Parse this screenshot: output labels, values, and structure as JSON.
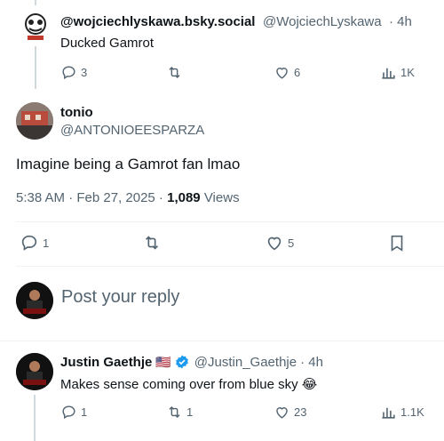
{
  "tweet1": {
    "display_name": "@wojciechlyskawa.bsky.social",
    "handle": "@WojciechLyskawa",
    "time": "· 4h",
    "text": "Ducked Gamrot",
    "actions": {
      "replies": "3",
      "likes": "6",
      "views": "1K"
    }
  },
  "main_tweet": {
    "display_name": "tonio",
    "handle": "@ANTONIOEESPARZA",
    "text": "Imagine being a Gamrot fan lmao",
    "timestamp": "5:38 AM · Feb 27, 2025 ·",
    "views_count": "1,089",
    "views_label": "Views",
    "actions": {
      "replies": "1",
      "likes": "5"
    }
  },
  "reply_box": {
    "placeholder": "Post your reply"
  },
  "tweet3": {
    "display_name": "Justin Gaethje",
    "flag_emoji": "🇺🇸",
    "handle": "@Justin_Gaethje",
    "time": "· 4h",
    "text": "Makes sense coming over from blue sky",
    "emoji": "😂",
    "actions": {
      "replies": "1",
      "retweets": "1",
      "likes": "23",
      "views": "1.1K"
    }
  },
  "colors": {
    "text": "#0f1419",
    "muted": "#536471",
    "verified": "#1d9bf0",
    "divider": "#eff3f4",
    "thread": "#cfd9de"
  }
}
